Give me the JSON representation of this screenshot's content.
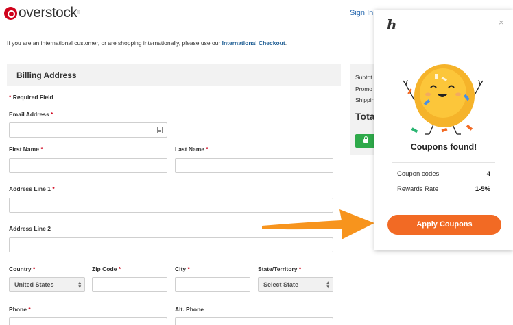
{
  "header": {
    "logo_text": "overstock",
    "logo_mark": "®",
    "sign_in": "Sign In"
  },
  "notice": {
    "text": "If you are an international customer, or are shopping internationally, please use our ",
    "link": "International Checkout",
    "suffix": "."
  },
  "billing": {
    "title": "Billing Address",
    "required_note": "Required Field",
    "asterisk": "*",
    "fields": {
      "email": "Email Address",
      "first_name": "First Name",
      "last_name": "Last Name",
      "address1": "Address Line 1",
      "address2": "Address Line 2",
      "country": "Country",
      "zip": "Zip Code",
      "city": "City",
      "state": "State/Territory",
      "phone": "Phone",
      "alt_phone": "Alt. Phone"
    },
    "country_value": "United States",
    "state_value": "Select State"
  },
  "summary": {
    "subtotal": "Subtot",
    "promo": "Promo",
    "shipping": "Shippin",
    "total": "Tota"
  },
  "popup": {
    "logo": "h",
    "close": "×",
    "heading": "Coupons found!",
    "rows": [
      {
        "label": "Coupon codes",
        "value": "4"
      },
      {
        "label": "Rewards Rate",
        "value": "1-5%"
      }
    ],
    "apply_button": "Apply Coupons",
    "accent_color": "#f26a24"
  },
  "icons": {
    "contact_card": "contact-card-icon",
    "lock": "lock-icon",
    "close": "close-icon",
    "arrow": "arrow-right-icon"
  }
}
